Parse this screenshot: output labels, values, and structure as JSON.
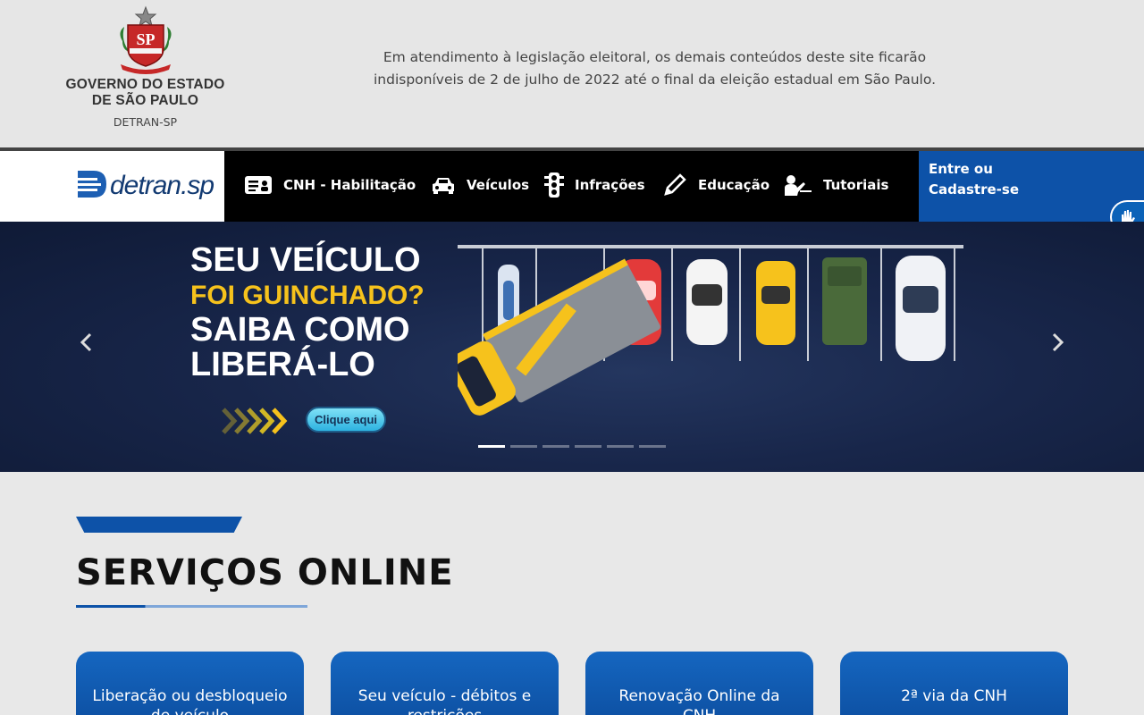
{
  "header": {
    "gov_name_line1": "GOVERNO DO ESTADO",
    "gov_name_line2": "DE SÃO PAULO",
    "gov_sub": "DETRAN-SP",
    "notice_line1": "Em atendimento à legislação eleitoral, os demais conteúdos deste site ficarão",
    "notice_line2": "indisponíveis de 2 de julho de 2022 até o final da eleição estadual em São Paulo."
  },
  "nav": {
    "brand": "detran.sp",
    "items": [
      {
        "label": "CNH - Habilitação",
        "icon": "id-card-icon"
      },
      {
        "label": "Veículos",
        "icon": "car-icon"
      },
      {
        "label": "Infrações",
        "icon": "traffic-light-icon"
      },
      {
        "label": "Educação",
        "icon": "pencil-icon"
      },
      {
        "label": "Tutoriais",
        "icon": "teacher-icon"
      }
    ],
    "login_line1": "Entre ou",
    "login_line2": "Cadastre-se"
  },
  "carousel": {
    "line1": "SEU VEÍCULO",
    "line2": "FOI GUINCHADO?",
    "line3": "SAIBA COMO",
    "line4": "LIBERÁ-LO",
    "cta": "Clique aqui",
    "slide_count": 6,
    "active_slide": 1
  },
  "services": {
    "title": "SERVIÇOS ONLINE",
    "cards": [
      {
        "label": "Liberação ou desbloqueio de veículo"
      },
      {
        "label": "Seu veículo - débitos e restrições"
      },
      {
        "label": "Renovação Online da CNH"
      },
      {
        "label": "2ª via da CNH"
      }
    ]
  },
  "colors": {
    "primary_blue": "#0d52a8",
    "nav_black": "#000000",
    "accent_yellow": "#f6c21c"
  }
}
